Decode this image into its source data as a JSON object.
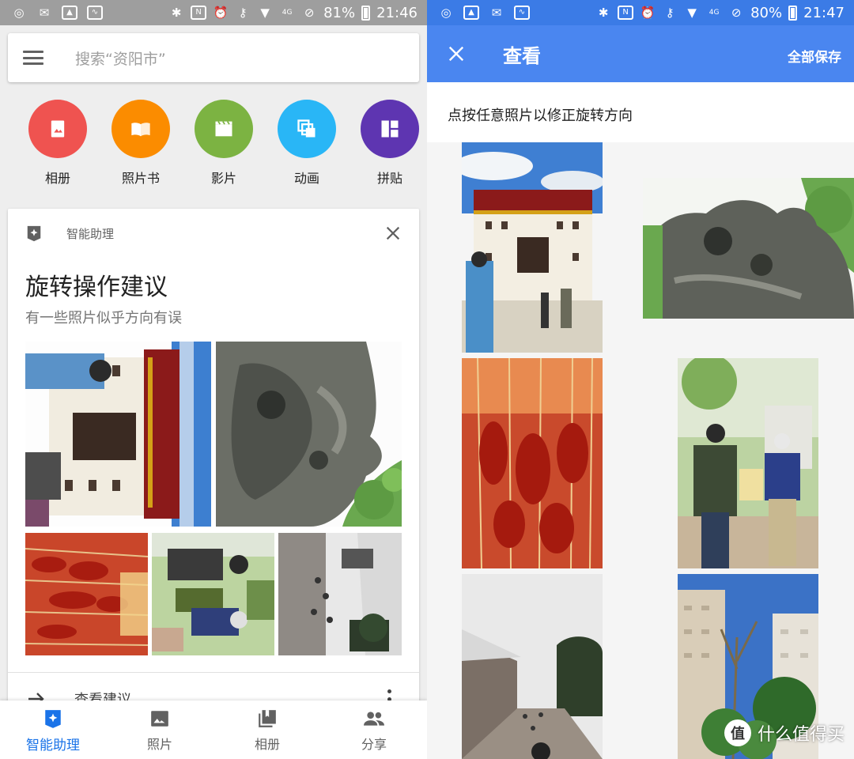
{
  "left": {
    "status": {
      "battery": "81%",
      "time": "21:46"
    },
    "search": {
      "placeholder": "搜索“资阳市”"
    },
    "creators": [
      {
        "label": "相册",
        "color": "#ef5350",
        "icon": "album-icon"
      },
      {
        "label": "照片书",
        "color": "#fb8c00",
        "icon": "photobook-icon"
      },
      {
        "label": "影片",
        "color": "#7cb342",
        "icon": "movie-icon"
      },
      {
        "label": "动画",
        "color": "#29b6f6",
        "icon": "animation-icon"
      },
      {
        "label": "拼贴",
        "color": "#5e35b1",
        "icon": "collage-icon"
      }
    ],
    "card": {
      "kicker": "智能助理",
      "title": "旋转操作建议",
      "subtitle": "有一些照片似乎方向有误",
      "action": "查看建议"
    },
    "nav": [
      {
        "label": "智能助理",
        "icon": "assistant-icon",
        "active": true
      },
      {
        "label": "照片",
        "icon": "photos-icon",
        "active": false
      },
      {
        "label": "相册",
        "icon": "albums-icon",
        "active": false
      },
      {
        "label": "分享",
        "icon": "sharing-icon",
        "active": false
      }
    ]
  },
  "right": {
    "status": {
      "battery": "80%",
      "time": "21:47"
    },
    "appbar": {
      "title": "查看",
      "action": "全部保存"
    },
    "hint": "点按任意照片以修正旋转方向"
  },
  "watermark": {
    "glyph": "值",
    "text": "什么值得买"
  },
  "colors": {
    "accent": "#1a73e8",
    "appbar": "#4a86f0"
  }
}
